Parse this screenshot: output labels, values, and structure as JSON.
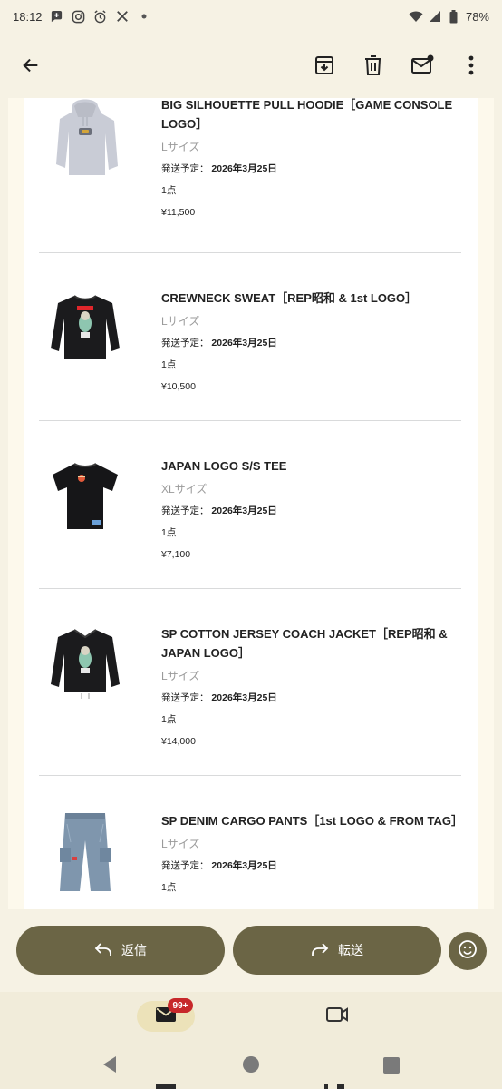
{
  "status_bar": {
    "time": "18:12",
    "battery": "78%",
    "icons": [
      "chat-plus-icon",
      "instagram-icon",
      "alarm-icon",
      "x-icon",
      "dot-icon",
      "wifi-icon",
      "signal-icon",
      "battery-icon"
    ]
  },
  "toolbar": {
    "icons": [
      "back-arrow-icon",
      "archive-icon",
      "delete-icon",
      "mark-unread-icon",
      "more-icon"
    ]
  },
  "items": [
    {
      "name": "BIG SILHOUETTE PULL HOODIE［GAME CONSOLE LOGO］",
      "size": "Lサイズ",
      "ship_label": "発送予定：",
      "ship_date": "2026年3月25日",
      "qty": "1点",
      "price": "¥11,500",
      "image": "grey-hoodie"
    },
    {
      "name": "CREWNECK SWEAT［REP昭和 & 1st LOGO］",
      "size": "Lサイズ",
      "ship_label": "発送予定：",
      "ship_date": "2026年3月25日",
      "qty": "1点",
      "price": "¥10,500",
      "image": "black-crewneck"
    },
    {
      "name": "JAPAN LOGO S/S TEE",
      "size": "XLサイズ",
      "ship_label": "発送予定：",
      "ship_date": "2026年3月25日",
      "qty": "1点",
      "price": "¥7,100",
      "image": "black-tee"
    },
    {
      "name": "SP COTTON JERSEY COACH JACKET［REP昭和 & JAPAN LOGO］",
      "size": "Lサイズ",
      "ship_label": "発送予定：",
      "ship_date": "2026年3月25日",
      "qty": "1点",
      "price": "¥14,000",
      "image": "black-jacket"
    },
    {
      "name": "SP DENIM CARGO PANTS［1st LOGO & FROM TAG］",
      "size": "Lサイズ",
      "ship_label": "発送予定：",
      "ship_date": "2026年3月25日",
      "qty": "1点",
      "price": "",
      "image": "denim-pants"
    }
  ],
  "actions": {
    "reply_label": "返信",
    "forward_label": "転送"
  },
  "bottom_nav": {
    "mail_badge": "99+"
  },
  "colors": {
    "background": "#f6f2e4",
    "accent": "#6b6545",
    "badge": "#c7282a"
  }
}
